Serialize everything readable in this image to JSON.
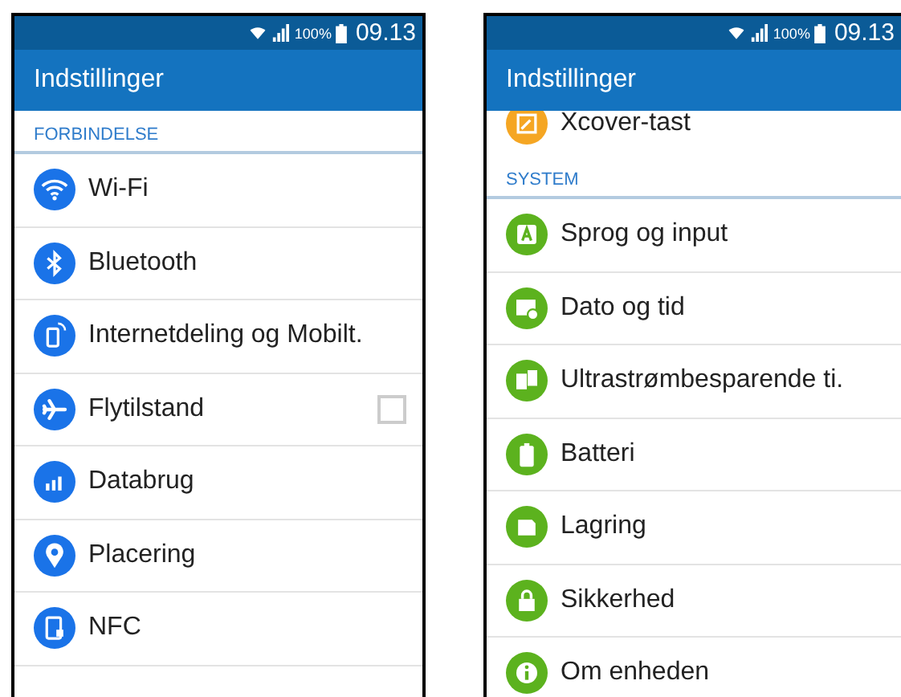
{
  "phones": [
    {
      "status_bar": {
        "battery_percent": "100%",
        "time": "09.13"
      },
      "title": "Indstillinger",
      "sections": [
        {
          "label": "FORBINDELSE",
          "items": [
            {
              "label": "Wi-Fi",
              "kind": "link",
              "color": "#1a73e8"
            },
            {
              "label": "Bluetooth",
              "kind": "link",
              "color": "#1a73e8"
            },
            {
              "label": "Internetdeling og Mobilt.",
              "kind": "link",
              "color": "#1a73e8"
            },
            {
              "label": "Flytilstand",
              "kind": "checkbox",
              "checked": false,
              "color": "#1a73e8"
            },
            {
              "label": "Databrug",
              "kind": "link",
              "color": "#1a73e8"
            },
            {
              "label": "Placering",
              "kind": "link",
              "color": "#1a73e8"
            },
            {
              "label": "NFC",
              "kind": "link",
              "color": "#1a73e8"
            }
          ]
        }
      ]
    },
    {
      "status_bar": {
        "battery_percent": "100%",
        "time": "09.13"
      },
      "title": "Indstillinger",
      "sections": [
        {
          "items": [
            {
              "label": "Xcover-tast",
              "kind": "link",
              "color": "#f5a623"
            }
          ]
        },
        {
          "label": "SYSTEM",
          "items": [
            {
              "label": "Sprog og input",
              "kind": "link",
              "color": "#5cb21e"
            },
            {
              "label": "Dato og tid",
              "kind": "link",
              "color": "#5cb21e"
            },
            {
              "label": "Ultrastrømbesparende ti.",
              "kind": "link",
              "color": "#5cb21e"
            },
            {
              "label": "Batteri",
              "kind": "link",
              "color": "#5cb21e"
            },
            {
              "label": "Lagring",
              "kind": "link",
              "color": "#5cb21e"
            },
            {
              "label": "Sikkerhed",
              "kind": "link",
              "color": "#5cb21e"
            },
            {
              "label": "Om enheden",
              "kind": "link",
              "color": "#5cb21e"
            }
          ]
        }
      ]
    }
  ]
}
